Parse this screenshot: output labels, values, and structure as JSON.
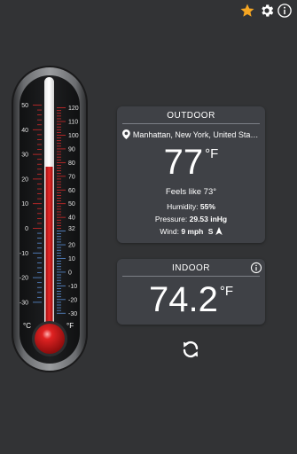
{
  "thermometer": {
    "celsius_ticks": [
      "50",
      "40",
      "30",
      "20",
      "10",
      "0",
      "-10",
      "-20",
      "-30"
    ],
    "fahrenheit_ticks": [
      "120",
      "110",
      "100",
      "90",
      "80",
      "70",
      "60",
      "50",
      "40",
      "32",
      "20",
      "10",
      "0",
      "-10",
      "-20",
      "-30"
    ],
    "celsius_unit": "°C",
    "fahrenheit_unit": "°F",
    "current_fahrenheit": 77,
    "colors": {
      "mercury": "#d21a1a",
      "red_scale": "#d42a2a",
      "blue_scale": "#5b8fd6"
    }
  },
  "outdoor": {
    "title": "OUTDOOR",
    "location": "Manhattan, New York, United States",
    "temperature": "77",
    "unit": "°F",
    "feels_like": "Feels like 73°",
    "humidity_label": "Humidity:",
    "humidity_value": "55%",
    "pressure_label": "Pressure:",
    "pressure_value": "29.53 inHg",
    "wind_label": "Wind:",
    "wind_value": "9 mph",
    "wind_dir": "S"
  },
  "indoor": {
    "title": "INDOOR",
    "temperature": "74.2",
    "unit": "°F"
  },
  "icons": {
    "favorite": "star-icon",
    "settings": "gear-icon",
    "info": "info-icon",
    "location": "location-pin-icon",
    "wind": "wind-arrow-icon",
    "refresh": "refresh-icon"
  },
  "colors": {
    "accent_star": "#f5a623",
    "background": "#323335",
    "card": "#3f4146"
  }
}
